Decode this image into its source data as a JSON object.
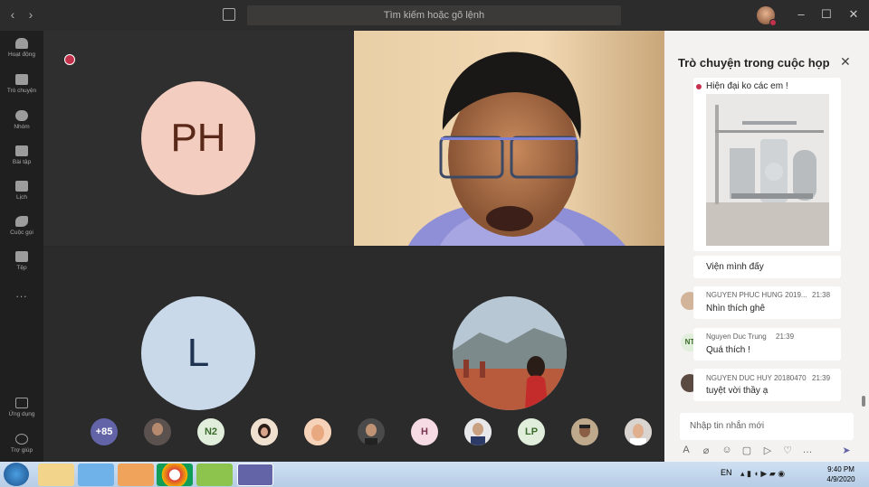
{
  "topbar": {
    "search_placeholder": "Tìm kiếm hoặc gõ lệnh",
    "back_icon": "chevron-left-icon",
    "forward_icon": "chevron-right-icon",
    "window_controls": [
      "minimize",
      "maximize",
      "close"
    ]
  },
  "rail": {
    "items": [
      {
        "label": "Hoạt động",
        "icon": "bell-icon"
      },
      {
        "label": "Trò chuyện",
        "icon": "chat-icon"
      },
      {
        "label": "Nhóm",
        "icon": "teams-icon"
      },
      {
        "label": "Bài tập",
        "icon": "assignments-icon"
      },
      {
        "label": "Lịch",
        "icon": "calendar-icon"
      },
      {
        "label": "Cuộc gọi",
        "icon": "phone-icon"
      },
      {
        "label": "Tệp",
        "icon": "files-icon"
      },
      {
        "label": "...",
        "icon": "more-icon"
      }
    ],
    "bottom": [
      {
        "label": "Ứng dụng",
        "icon": "apps-icon"
      },
      {
        "label": "Trợ giúp",
        "icon": "help-icon"
      }
    ]
  },
  "stage": {
    "tile1_initials": "PH",
    "tile3_initials": "L",
    "roster": [
      "+85",
      "",
      "N2",
      "",
      "",
      "",
      "H",
      "",
      "LP",
      "",
      ""
    ]
  },
  "chat": {
    "title": "Trò chuyện trong cuộc họp",
    "messages": [
      {
        "text": "Hiện đại ko các em !"
      },
      {
        "text": "Viện mình đấy"
      },
      {
        "name": "NGUYEN PHUC HUNG 2019...",
        "time": "21:38",
        "text": "Nhìn thích ghê"
      },
      {
        "name": "Nguyen Duc Trung",
        "time": "21:39",
        "text": "Quá thích !",
        "initials": "NT"
      },
      {
        "name": "NGUYEN DUC HUY 20180470",
        "time": "21:39",
        "text": "tuyệt vời thầy ạ"
      }
    ],
    "compose_placeholder": "Nhập tin nhắn mới"
  },
  "taskbar": {
    "lang": "EN",
    "time": "9:40 PM",
    "date": "4/9/2020"
  },
  "colors": {
    "ph_avatar": "#f2cdc0",
    "l_avatar": "#c9d9ea",
    "teams_purple": "#6264a7",
    "status_busy": "#c4314b"
  }
}
